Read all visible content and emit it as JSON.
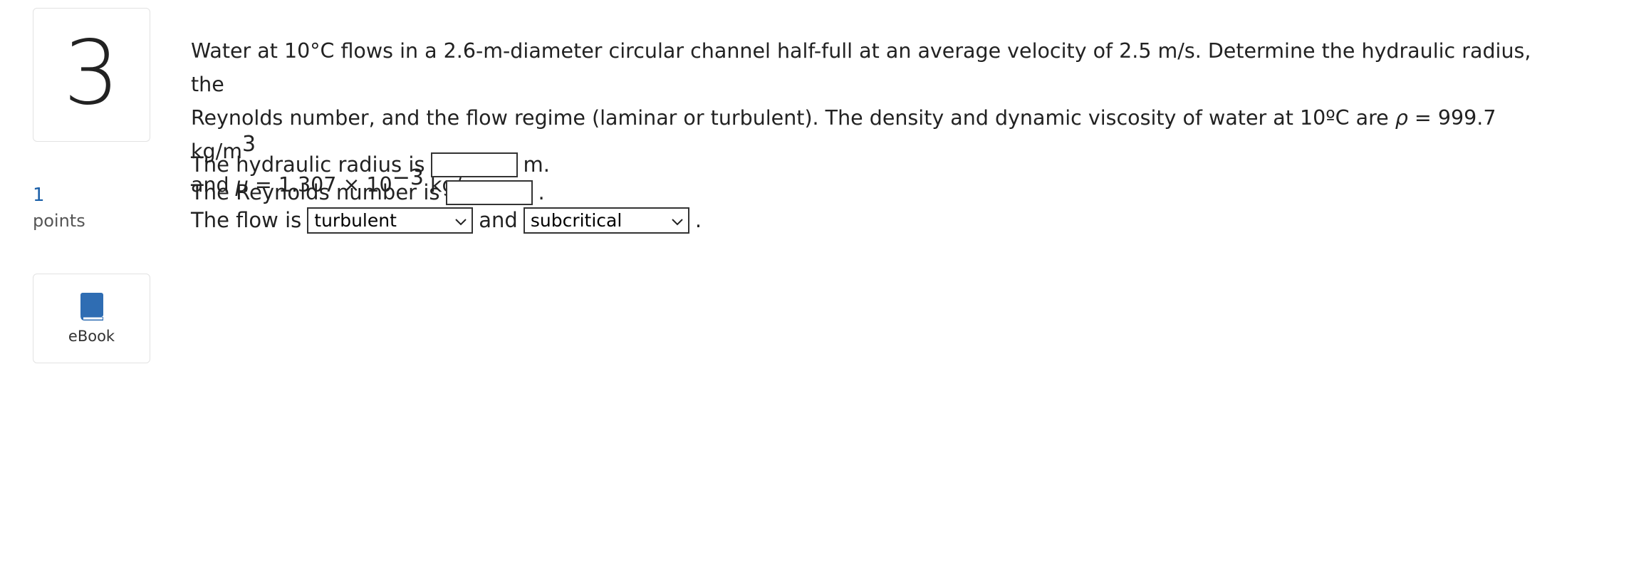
{
  "question": {
    "number": "3",
    "points_value": "1",
    "points_label": "points",
    "ebook_label": "eBook",
    "text": {
      "p1": "Water at 10°C flows in a 2.6-m-diameter circular channel half-full at an average velocity of 2.5 m/s. Determine the hydraulic radius, the",
      "p2a": "Reynolds number, and the flow regime (laminar or turbulent). The density and dynamic viscosity of water at 10ºC are ",
      "rho": "ρ",
      "p2b": " = 999.7 kg/m",
      "exp3": "3",
      "p3a": "and ",
      "mu": "μ",
      "p3b": " = 1.307 × 10",
      "exp_neg3": "−3",
      "p3c": " kg/m·s."
    }
  },
  "answers": {
    "hydraulic_radius_label": "The hydraulic radius is",
    "hydraulic_radius_value": "",
    "hydraulic_radius_unit": "m.",
    "reynolds_label": "The Reynolds number is",
    "reynolds_value": "",
    "reynolds_end": ".",
    "flow_label": "The flow is",
    "flow_type_selected": "turbulent",
    "and_label": "and",
    "flow_criticality_selected": "subcritical",
    "flow_end": "."
  },
  "colors": {
    "points_value": "#1a5fa8",
    "ebook_icon": "#2f6db3",
    "border": "#e2e2e2"
  },
  "icons": {
    "ebook": "book-icon",
    "dropdown": "chevron-down-icon"
  }
}
